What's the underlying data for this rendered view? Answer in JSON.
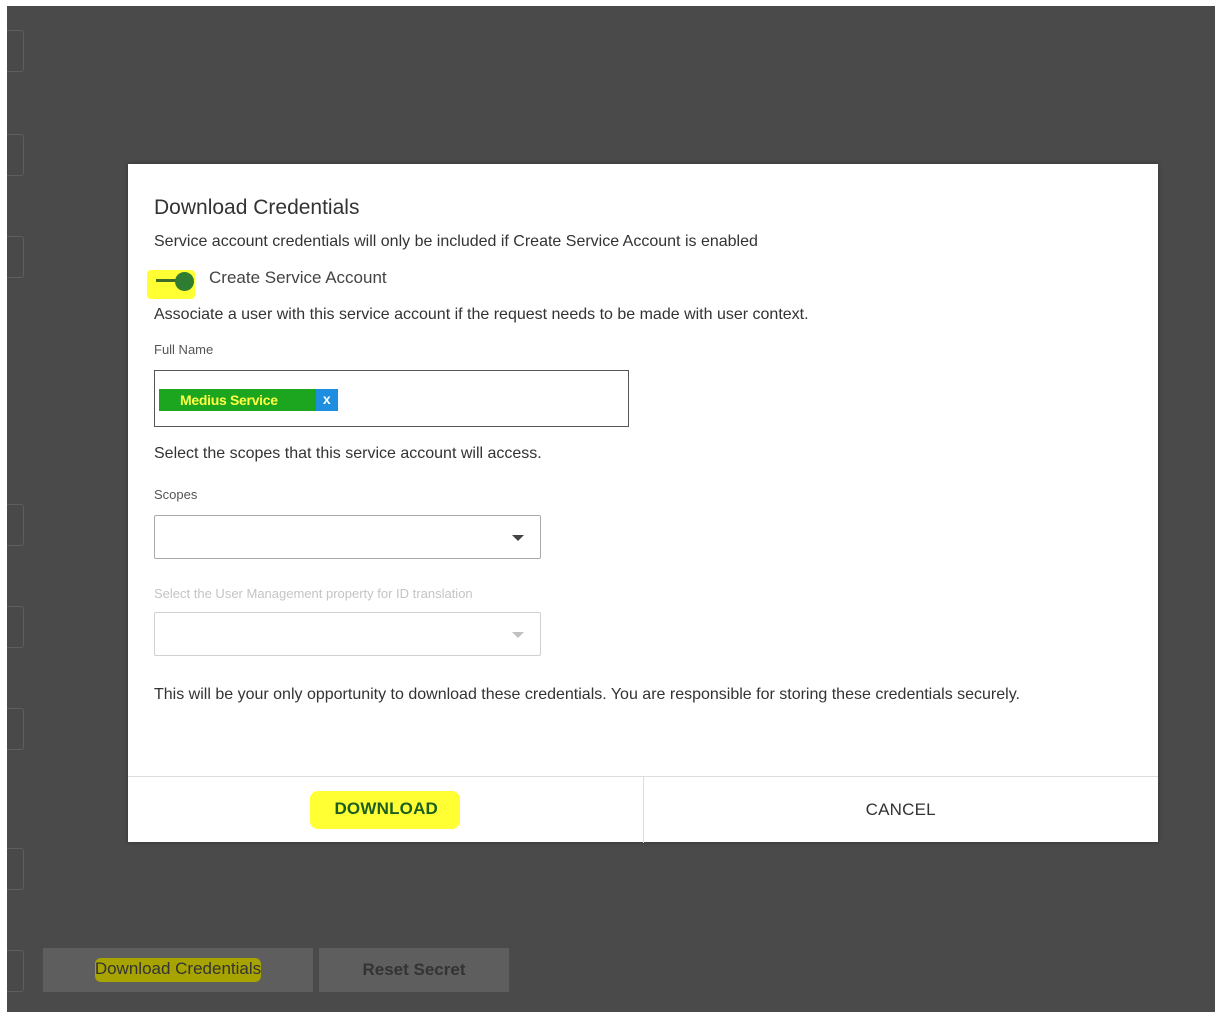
{
  "background": {
    "download_credentials_label": "Download Credentials",
    "reset_secret_label": "Reset Secret"
  },
  "modal": {
    "title": "Download Credentials",
    "info_text": "Service account credentials will only be included if Create Service Account is enabled",
    "toggle": {
      "label": "Create Service Account",
      "checked": true
    },
    "associate_text": "Associate a user with this service account if the request needs to be made with user context.",
    "full_name": {
      "label": "Full Name",
      "chip_value": "Medius Service",
      "chip_remove": "x"
    },
    "scopes_intro": "Select the scopes that this service account will access.",
    "scopes": {
      "label": "Scopes",
      "value": ""
    },
    "id_translation": {
      "label": "Select the User Management property for ID translation",
      "value": "",
      "disabled": true
    },
    "warning_text": "This will be your only opportunity to download these credentials. You are responsible for storing these credentials securely.",
    "download_label": "DOWNLOAD",
    "cancel_label": "CANCEL"
  },
  "colors": {
    "overlay": "#4a4a4a",
    "highlight": "#ffff33",
    "chip_bg": "#1ca51f",
    "chip_remove_bg": "#1e8ee0",
    "toggle_on": "#2f7d32"
  }
}
